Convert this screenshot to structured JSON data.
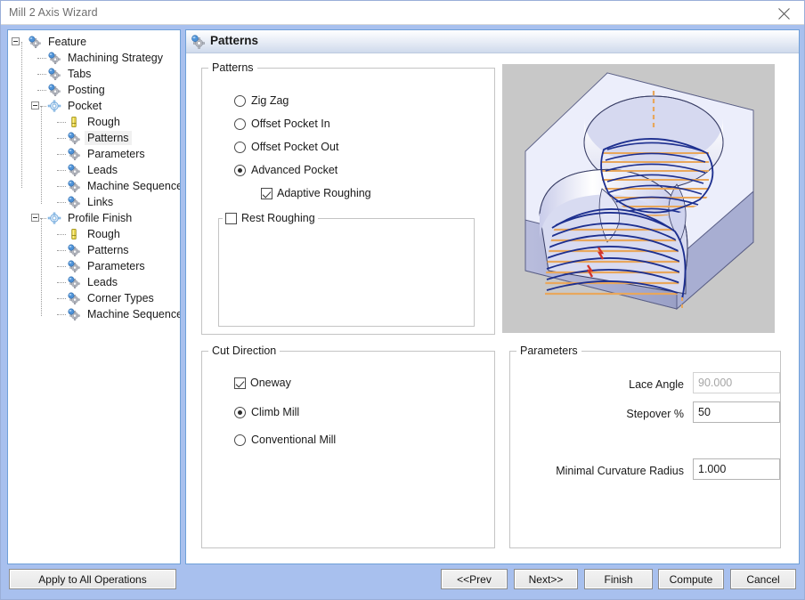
{
  "window": {
    "title": "Mill 2 Axis Wizard",
    "close_icon": "close-icon",
    "frame_color": "#a8c0ee",
    "accent_border": "#6fa0d8"
  },
  "tree": {
    "nodes": [
      {
        "label": "Feature",
        "depth": 0,
        "icon": "gear-blue-icon",
        "expander": "collapse",
        "selected": false
      },
      {
        "label": "Machining Strategy",
        "depth": 1,
        "icon": "gear-blue-icon",
        "expander": "none",
        "selected": false
      },
      {
        "label": "Tabs",
        "depth": 1,
        "icon": "gear-blue-icon",
        "expander": "none",
        "selected": false
      },
      {
        "label": "Posting",
        "depth": 1,
        "icon": "gear-blue-icon",
        "expander": "none",
        "selected": false
      },
      {
        "label": "Pocket",
        "depth": 1,
        "icon": "gear-light-icon",
        "expander": "collapse",
        "selected": false
      },
      {
        "label": "Rough",
        "depth": 2,
        "icon": "tool-yellow-icon",
        "expander": "none",
        "selected": false
      },
      {
        "label": "Patterns",
        "depth": 2,
        "icon": "gear-blue-icon",
        "expander": "none",
        "selected": true
      },
      {
        "label": "Parameters",
        "depth": 2,
        "icon": "gear-blue-icon",
        "expander": "none",
        "selected": false
      },
      {
        "label": "Leads",
        "depth": 2,
        "icon": "gear-blue-icon",
        "expander": "none",
        "selected": false
      },
      {
        "label": "Machine Sequence",
        "depth": 2,
        "icon": "gear-blue-icon",
        "expander": "none",
        "selected": false
      },
      {
        "label": "Links",
        "depth": 2,
        "icon": "gear-blue-icon",
        "expander": "none",
        "selected": false
      },
      {
        "label": "Profile Finish",
        "depth": 1,
        "icon": "gear-light-icon",
        "expander": "collapse",
        "selected": false
      },
      {
        "label": "Rough",
        "depth": 2,
        "icon": "tool-yellow-icon",
        "expander": "none",
        "selected": false
      },
      {
        "label": "Patterns",
        "depth": 2,
        "icon": "gear-blue-icon",
        "expander": "none",
        "selected": false
      },
      {
        "label": "Parameters",
        "depth": 2,
        "icon": "gear-blue-icon",
        "expander": "none",
        "selected": false
      },
      {
        "label": "Leads",
        "depth": 2,
        "icon": "gear-blue-icon",
        "expander": "none",
        "selected": false
      },
      {
        "label": "Corner Types",
        "depth": 2,
        "icon": "gear-blue-icon",
        "expander": "none",
        "selected": false
      },
      {
        "label": "Machine Sequence",
        "depth": 2,
        "icon": "gear-blue-icon",
        "expander": "none",
        "selected": false
      }
    ]
  },
  "panel": {
    "header_title": "Patterns",
    "header_icon": "gear-blue-icon"
  },
  "patterns_group": {
    "legend": "Patterns",
    "options": [
      {
        "label": "Zig Zag",
        "checked": false
      },
      {
        "label": "Offset Pocket In",
        "checked": false
      },
      {
        "label": "Offset Pocket Out",
        "checked": false
      },
      {
        "label": "Advanced Pocket",
        "checked": true
      }
    ],
    "adaptive_roughing": {
      "label": "Adaptive Roughing",
      "checked": true
    },
    "rest_roughing": {
      "label": "Rest Roughing",
      "checked": false
    }
  },
  "cut_direction_group": {
    "legend": "Cut Direction",
    "oneway": {
      "label": "Oneway",
      "checked": true
    },
    "climb_mill": {
      "label": "Climb Mill",
      "checked": true
    },
    "conventional_mill": {
      "label": "Conventional Mill",
      "checked": false
    }
  },
  "parameters_group": {
    "legend": "Parameters",
    "fields": [
      {
        "label": "Lace Angle",
        "value": "90.000",
        "disabled": true
      },
      {
        "label": "Stepover %",
        "value": "50",
        "disabled": false
      },
      {
        "label": "Minimal Curvature Radius",
        "value": "1.000",
        "disabled": false
      }
    ]
  },
  "preview": {
    "name": "toolpath-3d-preview",
    "background": "#c8c8c8",
    "stock_fill": "#e4e4f4",
    "toolpath_blue": "#1d2f8f",
    "toolpath_orange": "#e8a75c",
    "marker_red": "#d4352a"
  },
  "footer": {
    "apply_all": "Apply to All Operations",
    "buttons": [
      {
        "label": "<<Prev"
      },
      {
        "label": "Next>>"
      },
      {
        "label": "Finish"
      },
      {
        "label": "Compute"
      },
      {
        "label": "Cancel"
      }
    ]
  }
}
